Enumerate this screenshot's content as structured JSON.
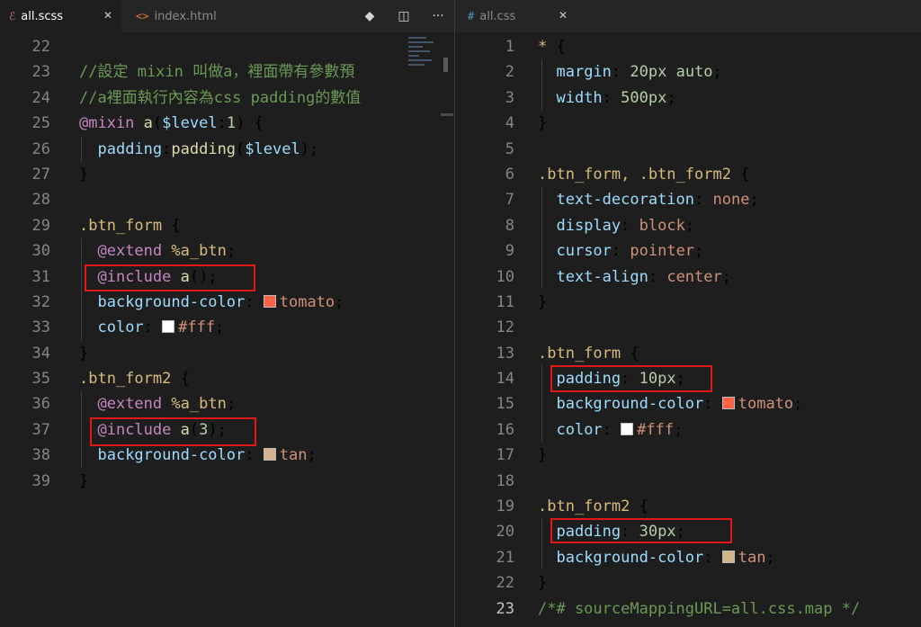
{
  "left_pane": {
    "tabs": [
      {
        "icon": "sass-icon",
        "glyph": "ℰ",
        "label": "all.scss",
        "close": "✕",
        "active": true
      },
      {
        "icon": "html-icon",
        "glyph": "<>",
        "label": "index.html",
        "close": "",
        "active": false
      }
    ],
    "actions": [
      "git-compare-icon",
      "split-editor-icon",
      "more-actions-icon"
    ],
    "action_glyphs": [
      "◆",
      "◫",
      "···"
    ],
    "lines": [
      {
        "n": "22",
        "t": ""
      },
      {
        "n": "23",
        "t": "//設定 mixin 叫做a，裡面帶有參數預"
      },
      {
        "n": "24",
        "t": "//a裡面執行內容為css padding的數值"
      },
      {
        "n": "25",
        "t": "@mixin a($level:1) {"
      },
      {
        "n": "26",
        "t": "  padding:padding($level);"
      },
      {
        "n": "27",
        "t": "}"
      },
      {
        "n": "28",
        "t": ""
      },
      {
        "n": "29",
        "t": ".btn_form {"
      },
      {
        "n": "30",
        "t": "  @extend %a_btn;"
      },
      {
        "n": "31",
        "t": "  @include a();"
      },
      {
        "n": "32",
        "t": "  background-color: tomato;"
      },
      {
        "n": "33",
        "t": "  color: #fff;"
      },
      {
        "n": "34",
        "t": "}"
      },
      {
        "n": "35",
        "t": ".btn_form2 {"
      },
      {
        "n": "36",
        "t": "  @extend %a_btn;"
      },
      {
        "n": "37",
        "t": "  @include a(3);"
      },
      {
        "n": "38",
        "t": "  background-color: tan;"
      },
      {
        "n": "39",
        "t": "}"
      }
    ]
  },
  "right_pane": {
    "tabs": [
      {
        "icon": "css-icon",
        "glyph": "#",
        "label": "all.css",
        "close": "✕",
        "active": false
      }
    ],
    "lines": [
      {
        "n": "1",
        "t": "* {"
      },
      {
        "n": "2",
        "t": "  margin: 20px auto;"
      },
      {
        "n": "3",
        "t": "  width: 500px;"
      },
      {
        "n": "4",
        "t": "}"
      },
      {
        "n": "5",
        "t": ""
      },
      {
        "n": "6",
        "t": ".btn_form, .btn_form2 {"
      },
      {
        "n": "7",
        "t": "  text-decoration: none;"
      },
      {
        "n": "8",
        "t": "  display: block;"
      },
      {
        "n": "9",
        "t": "  cursor: pointer;"
      },
      {
        "n": "10",
        "t": "  text-align: center;"
      },
      {
        "n": "11",
        "t": "}"
      },
      {
        "n": "12",
        "t": ""
      },
      {
        "n": "13",
        "t": ".btn_form {"
      },
      {
        "n": "14",
        "t": "  padding: 10px;"
      },
      {
        "n": "15",
        "t": "  background-color: tomato;"
      },
      {
        "n": "16",
        "t": "  color: #fff;"
      },
      {
        "n": "17",
        "t": "}"
      },
      {
        "n": "18",
        "t": ""
      },
      {
        "n": "19",
        "t": ".btn_form2 {"
      },
      {
        "n": "20",
        "t": "  padding: 30px;"
      },
      {
        "n": "21",
        "t": "  background-color: tan;"
      },
      {
        "n": "22",
        "t": "}"
      },
      {
        "n": "23",
        "t": "/*# sourceMappingURL=all.css.map */"
      }
    ]
  },
  "colors": {
    "tomato": "#ff6347",
    "white": "#ffffff",
    "tan": "#d2b48c",
    "highlight": "#e31919"
  }
}
